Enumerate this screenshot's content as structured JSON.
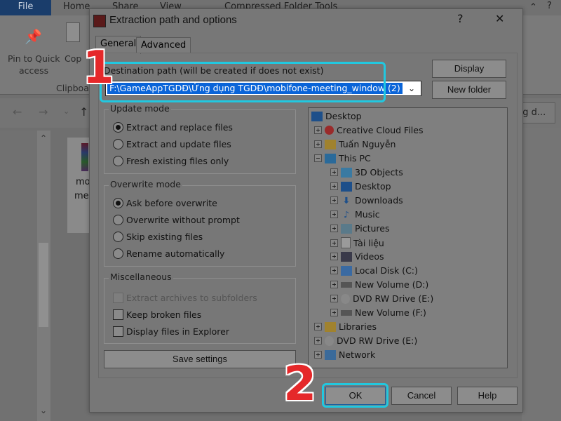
{
  "explorer": {
    "tabs": [
      "File",
      "Home",
      "Share",
      "View",
      "Compressed Folder Tools"
    ],
    "pin_label_1": "Pin to Quick",
    "pin_label_2": "access",
    "copy_label": "Cop",
    "clipboard_label": "Clipboa",
    "search_partial": "ng d...",
    "file_label_1": "mo",
    "file_label_2": "me"
  },
  "dialog": {
    "title": "Extraction path and options",
    "help_button": "?",
    "close_button": "✕",
    "tabs": [
      "General",
      "Advanced"
    ],
    "destination_label": "Destination path (will be created if does not exist)",
    "destination_value": "F:\\GameAppTGDĐ\\Ứng dụng TGDĐ\\mobifone-meeting_window (2)",
    "display_button": "Display",
    "new_folder_button": "New folder",
    "update_mode": {
      "title": "Update mode",
      "options": [
        "Extract and replace files",
        "Extract and update files",
        "Fresh existing files only"
      ],
      "selected": "Extract and replace files"
    },
    "overwrite_mode": {
      "title": "Overwrite mode",
      "options": [
        "Ask before overwrite",
        "Overwrite without prompt",
        "Skip existing files",
        "Rename automatically"
      ],
      "selected": "Ask before overwrite"
    },
    "misc": {
      "title": "Miscellaneous",
      "options": [
        "Extract archives to subfolders",
        "Keep broken files",
        "Display files in Explorer"
      ]
    },
    "save_settings_button": "Save settings",
    "ok_button": "OK",
    "cancel_button": "Cancel",
    "help_label": "Help",
    "tree": [
      "Desktop",
      "Creative Cloud Files",
      "Tuấn Nguyễn",
      "This PC",
      "3D Objects",
      "Desktop",
      "Downloads",
      "Music",
      "Pictures",
      "Tài liệu",
      "Videos",
      "Local Disk (C:)",
      "New Volume (D:)",
      "DVD RW Drive (E:)",
      "New Volume (F:)",
      "Libraries",
      "DVD RW Drive (E:)",
      "Network"
    ]
  },
  "callouts": {
    "step1": "1",
    "step2": "2"
  },
  "colors": {
    "highlight": "#21c8e0",
    "callout": "#e5282a",
    "selection": "#0a64d8"
  }
}
